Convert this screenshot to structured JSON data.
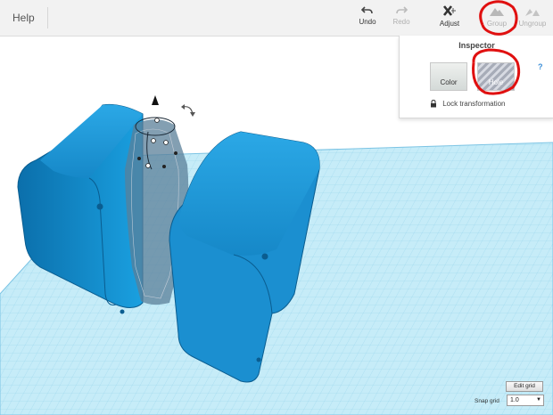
{
  "toolbar": {
    "help_label": "Help",
    "undo_label": "Undo",
    "redo_label": "Redo",
    "adjust_label": "Adjust",
    "group_label": "Group",
    "ungroup_label": "Ungroup"
  },
  "inspector": {
    "title": "Inspector",
    "color_label": "Color",
    "hole_label": "Hole",
    "help_mark": "?",
    "lock_label": "Lock transformation"
  },
  "grid": {
    "edit_grid_label": "Edit grid",
    "snap_grid_label": "Snap grid",
    "snap_grid_value": "1.0"
  },
  "colors": {
    "shape_blue": "#1a8ccf",
    "grid_plane": "#c6ecf8",
    "annotation_red": "#e01010",
    "hole_stripes": "#a7acb8"
  }
}
